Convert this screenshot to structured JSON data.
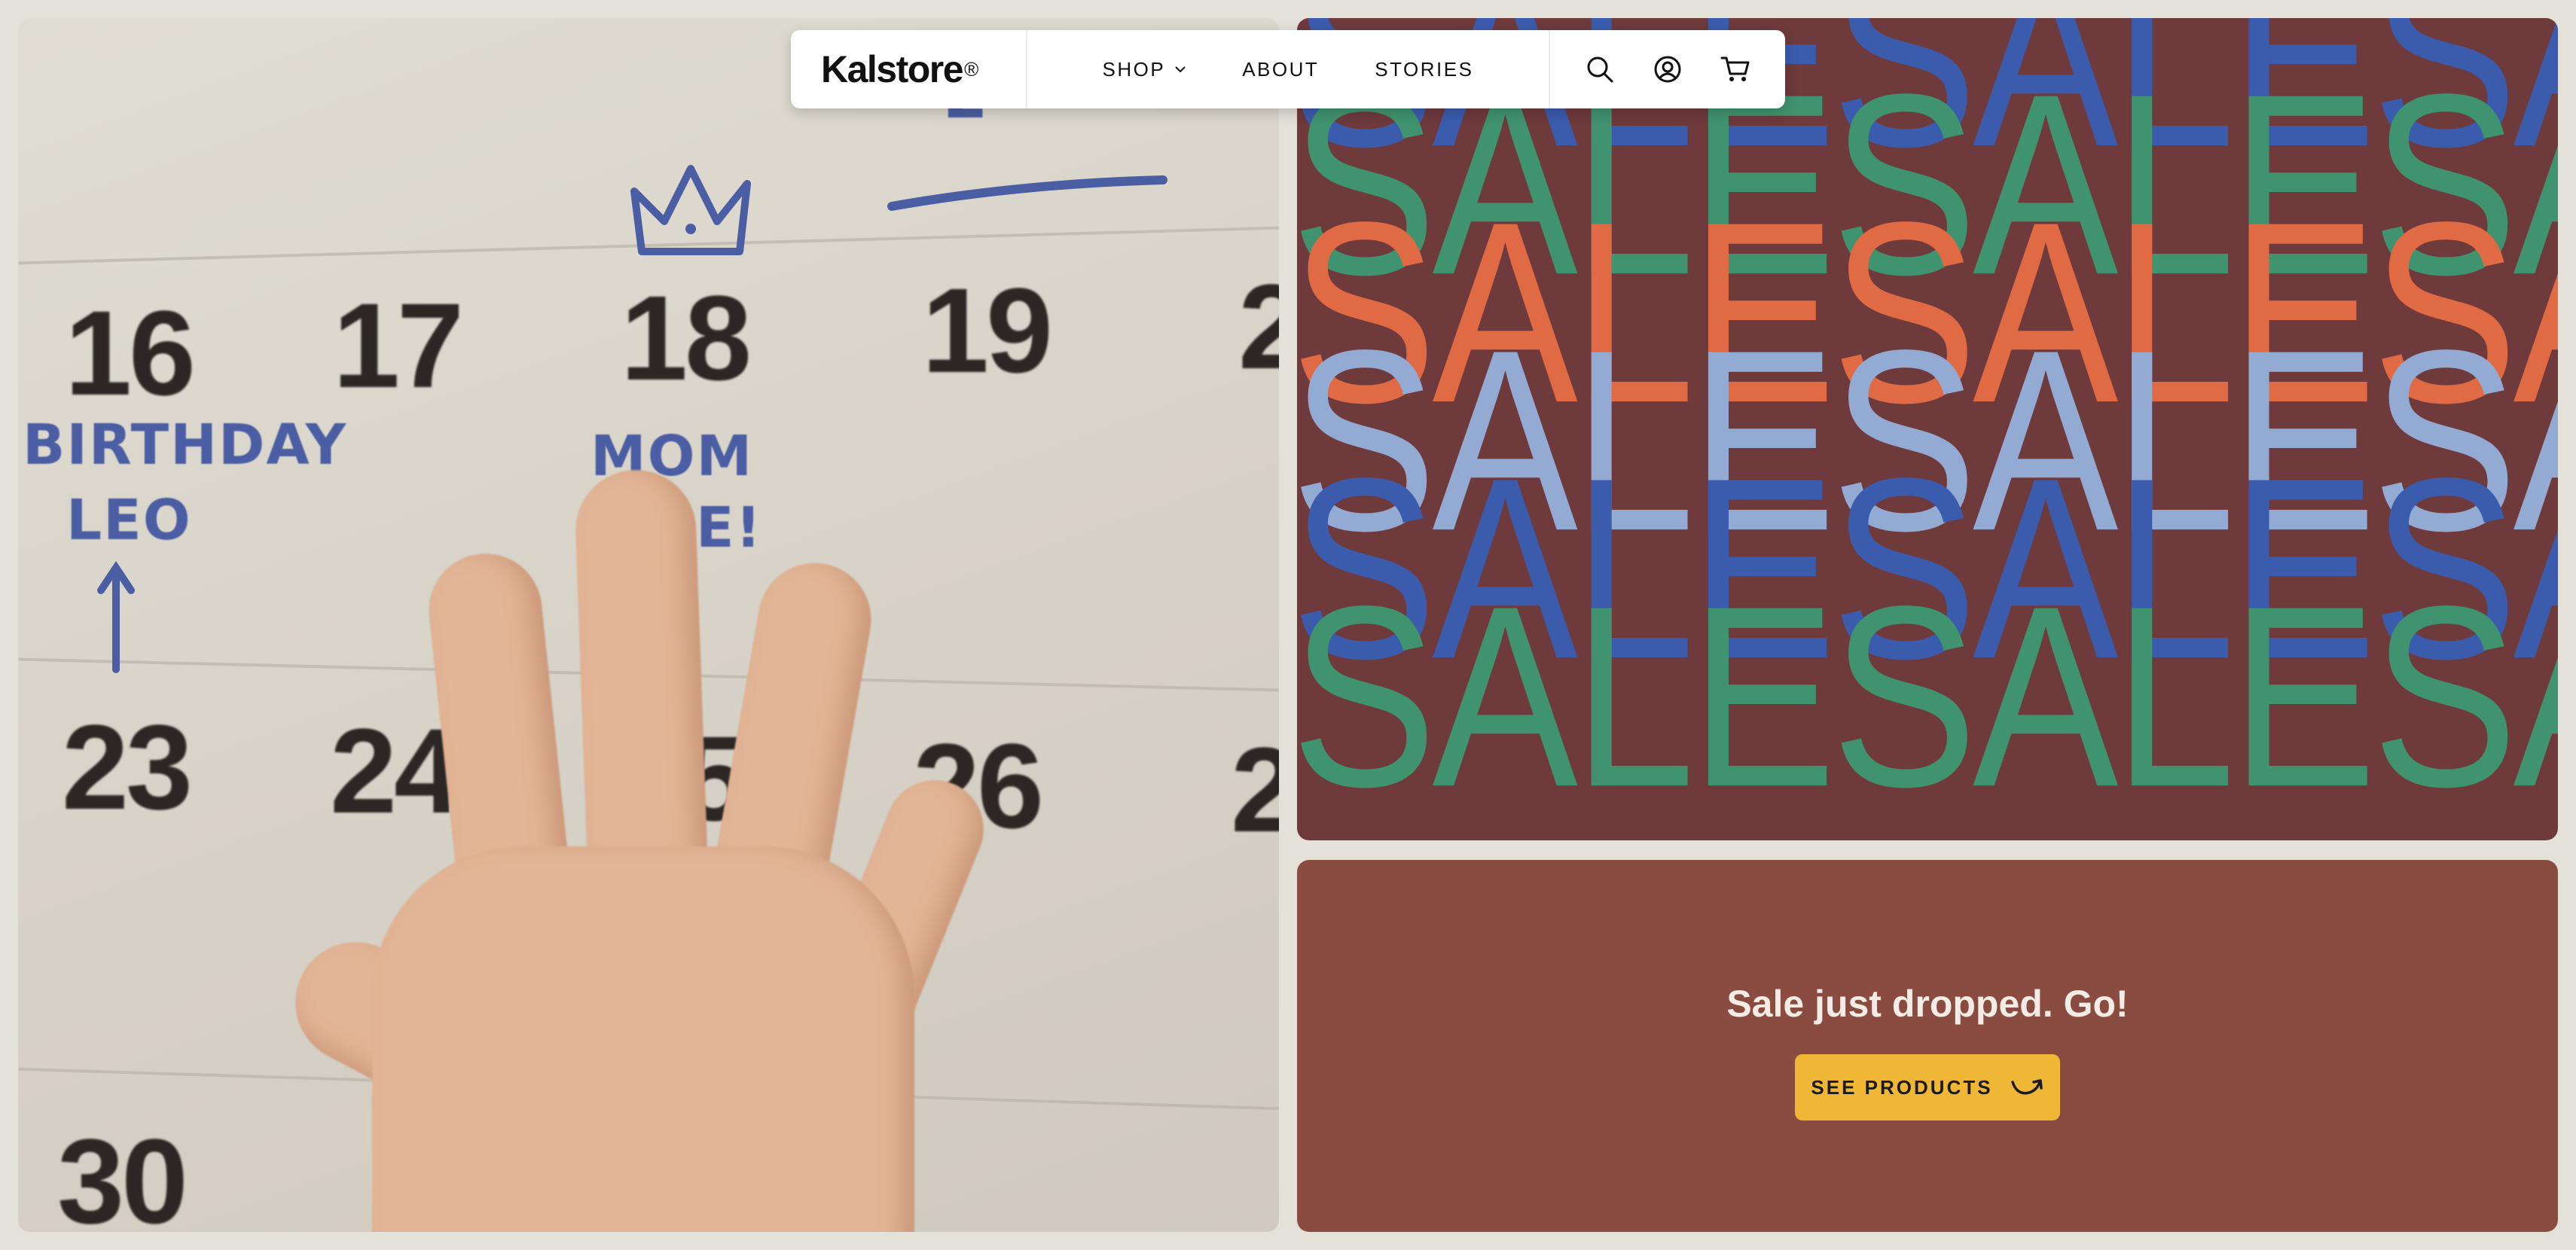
{
  "header": {
    "logo": "Kalstore",
    "logo_mark": "®",
    "nav": [
      {
        "label": "SHOP",
        "has_dropdown": true
      },
      {
        "label": "ABOUT",
        "has_dropdown": false
      },
      {
        "label": "STORIES",
        "has_dropdown": false
      }
    ],
    "icons": [
      "search-icon",
      "account-icon",
      "cart-icon"
    ]
  },
  "photo": {
    "calendar_numbers": [
      "16",
      "17",
      "18",
      "19",
      "2",
      "23",
      "24",
      "5",
      "26",
      "2",
      "30"
    ],
    "handwriting": [
      "BIRTHDAY",
      "LEO",
      "MOM",
      "E!",
      "2"
    ]
  },
  "sale_banner": {
    "word": "SALE",
    "background": "#6e3a3c",
    "row_colors": [
      "#3b5cad",
      "#40936f",
      "#e06a43",
      "#93abd2",
      "#3b5cad",
      "#40936f"
    ]
  },
  "promo": {
    "title": "Sale just dropped. Go!",
    "button_label": "SEE PRODUCTS",
    "button_color": "#f0b737",
    "background": "#8a4b40"
  }
}
